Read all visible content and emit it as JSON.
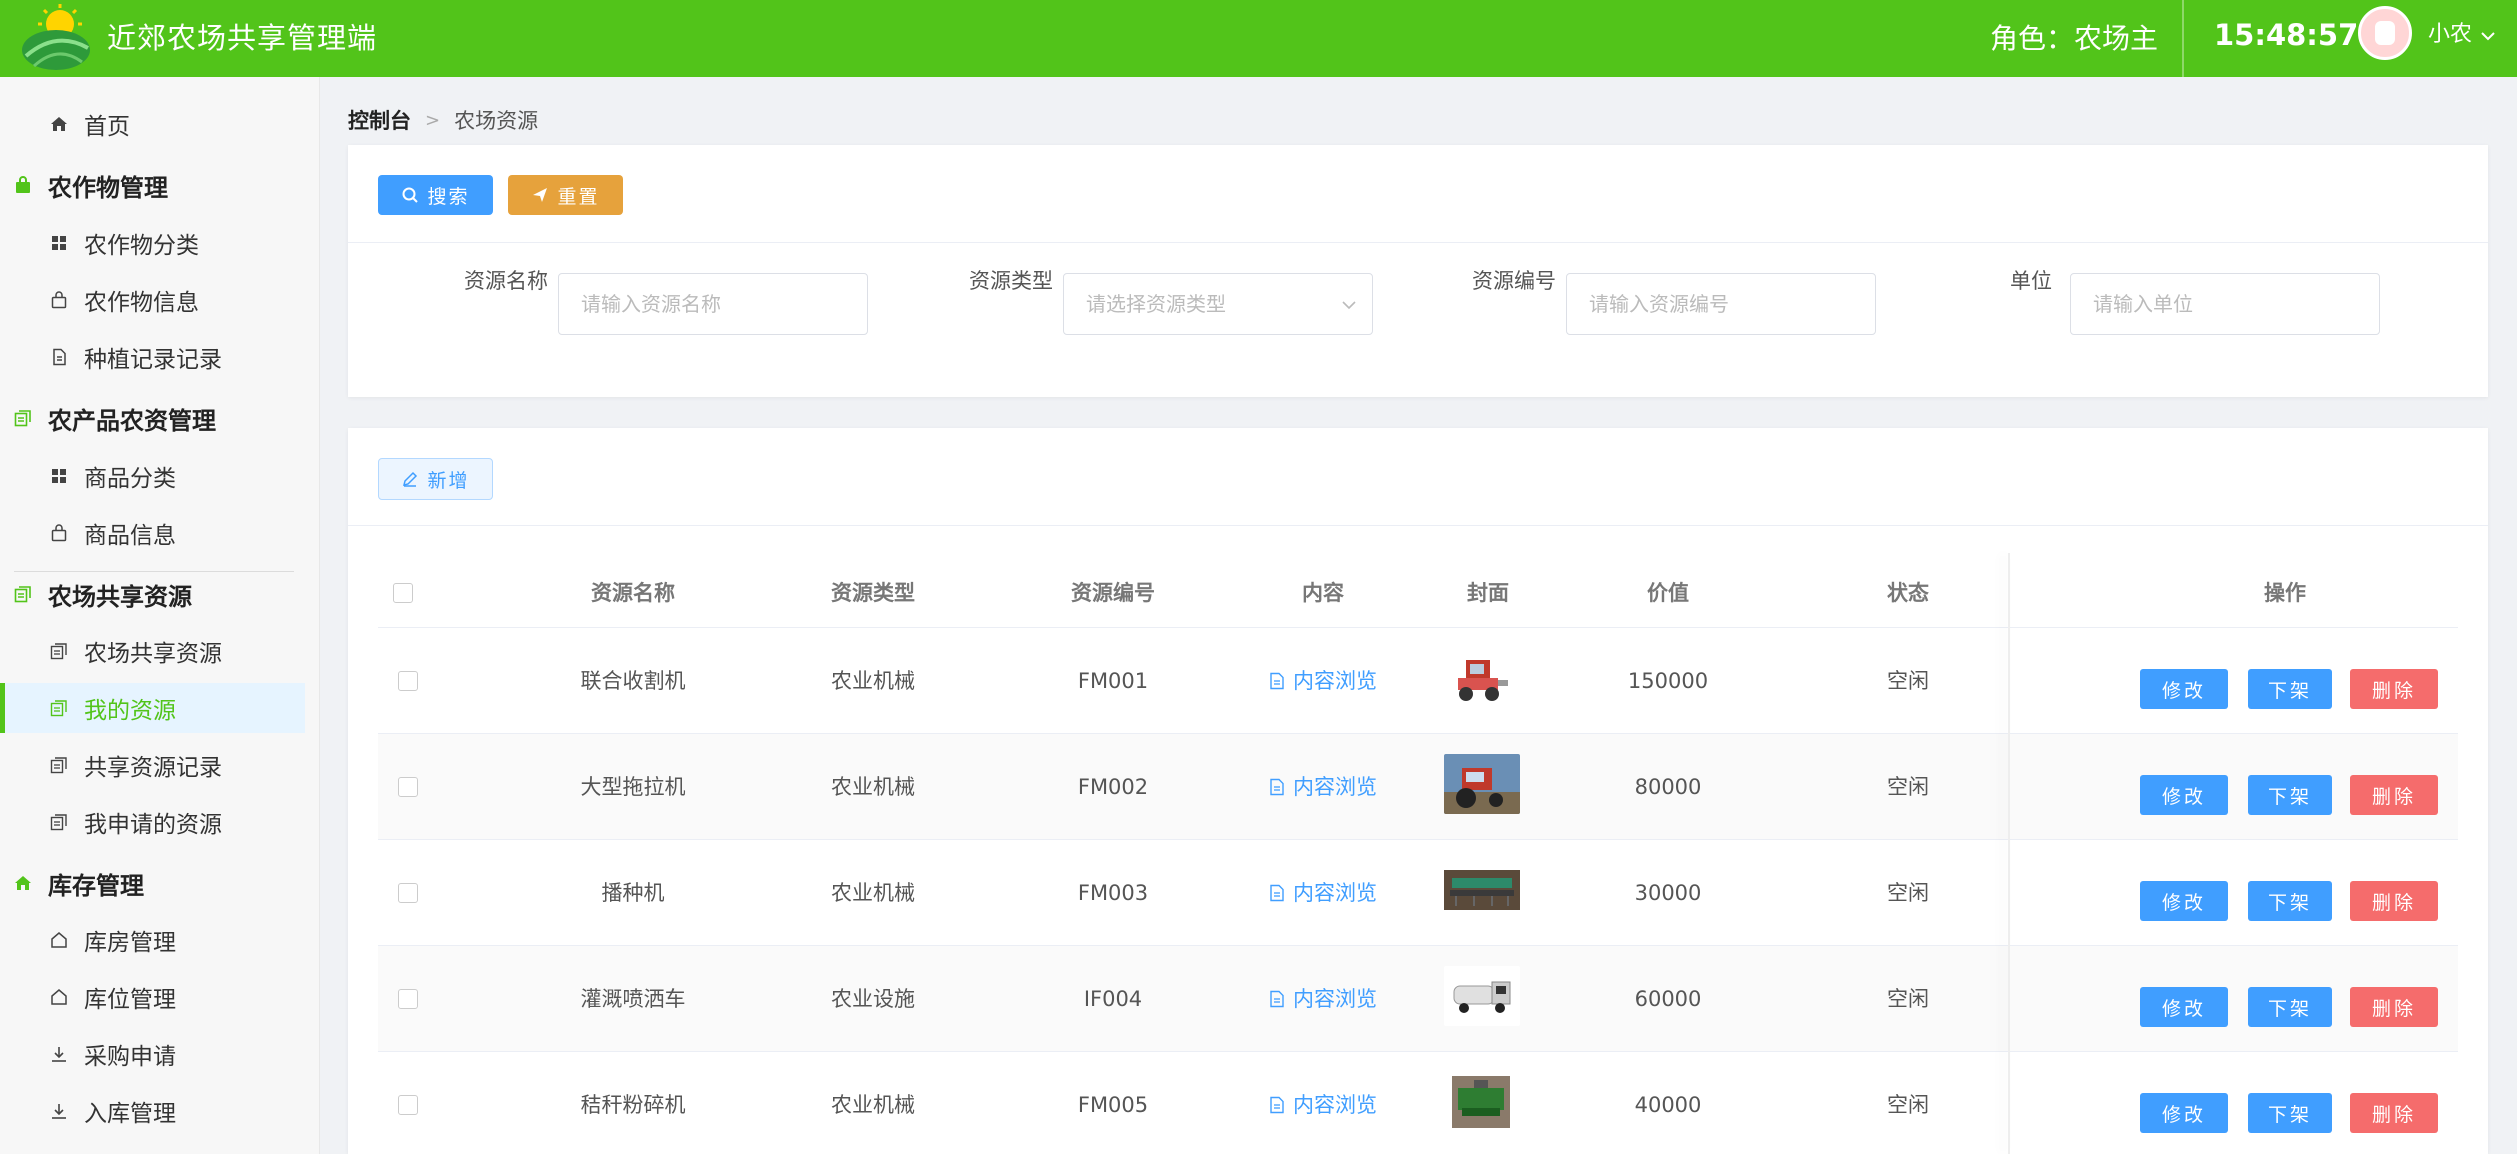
{
  "header": {
    "title": "近郊农场共享管理端",
    "role": "角色：农场主",
    "time": "15:48:57",
    "user_name": "小农"
  },
  "sidebar": {
    "items": [
      {
        "label": "首页",
        "type": "sub",
        "icon": "home-icon"
      },
      {
        "label": "农作物管理",
        "type": "group",
        "icon": "bag-icon"
      },
      {
        "label": "农作物分类",
        "type": "sub",
        "icon": "grid-icon"
      },
      {
        "label": "农作物信息",
        "type": "sub",
        "icon": "bag-outline-icon"
      },
      {
        "label": "种植记录记录",
        "type": "sub",
        "icon": "document-icon"
      },
      {
        "label": "农产品农资管理",
        "type": "group",
        "icon": "copy-icon"
      },
      {
        "label": "商品分类",
        "type": "sub",
        "icon": "grid-icon"
      },
      {
        "label": "商品信息",
        "type": "sub",
        "icon": "bag-outline-icon"
      },
      {
        "label": "农场共享资源",
        "type": "group",
        "icon": "copy-icon"
      },
      {
        "label": "农场共享资源",
        "type": "sub",
        "icon": "copy-outline-icon"
      },
      {
        "label": "我的资源",
        "type": "sub",
        "icon": "copy-outline-icon",
        "active": true
      },
      {
        "label": "共享资源记录",
        "type": "sub",
        "icon": "copy-outline-icon"
      },
      {
        "label": "我申请的资源",
        "type": "sub",
        "icon": "copy-outline-icon"
      },
      {
        "label": "库存管理",
        "type": "group",
        "icon": "home-icon"
      },
      {
        "label": "库房管理",
        "type": "sub",
        "icon": "house-outline-icon"
      },
      {
        "label": "库位管理",
        "type": "sub",
        "icon": "house-outline-icon"
      },
      {
        "label": "采购申请",
        "type": "sub",
        "icon": "download-icon"
      },
      {
        "label": "入库管理",
        "type": "sub",
        "icon": "download-icon"
      }
    ]
  },
  "breadcrumb": {
    "home": "控制台",
    "current": "农场资源"
  },
  "search": {
    "search_label": "搜索",
    "reset_label": "重置",
    "fields": [
      {
        "label": "资源名称",
        "placeholder": "请输入资源名称"
      },
      {
        "label": "资源类型",
        "placeholder": "请选择资源类型"
      },
      {
        "label": "资源编号",
        "placeholder": "请输入资源编号"
      },
      {
        "label": "单位",
        "placeholder": "请输入单位"
      }
    ]
  },
  "table": {
    "add_label": "新增",
    "columns": [
      "资源名称",
      "资源类型",
      "资源编号",
      "内容",
      "封面",
      "价值",
      "状态",
      "操作"
    ],
    "content_link": "内容浏览",
    "actions": {
      "edit": "修改",
      "off": "下架",
      "delete": "删除"
    },
    "rows": [
      {
        "name": "联合收割机",
        "type": "农业机械",
        "code": "FM001",
        "value": "150000",
        "status": "空闲",
        "cover": "harvester-image"
      },
      {
        "name": "大型拖拉机",
        "type": "农业机械",
        "code": "FM002",
        "value": "80000",
        "status": "空闲",
        "cover": "tractor-image"
      },
      {
        "name": "播种机",
        "type": "农业机械",
        "code": "FM003",
        "value": "30000",
        "status": "空闲",
        "cover": "seeder-image"
      },
      {
        "name": "灌溉喷洒车",
        "type": "农业设施",
        "code": "IF004",
        "value": "60000",
        "status": "空闲",
        "cover": "sprayer-truck-image"
      },
      {
        "name": "秸秆粉碎机",
        "type": "农业机械",
        "code": "FM005",
        "value": "40000",
        "status": "空闲",
        "cover": "straw-crusher-image"
      }
    ]
  },
  "colors": {
    "header": "#52c41a",
    "primary": "#409eff",
    "warning": "#e6a23c",
    "danger": "#f56c6c"
  }
}
